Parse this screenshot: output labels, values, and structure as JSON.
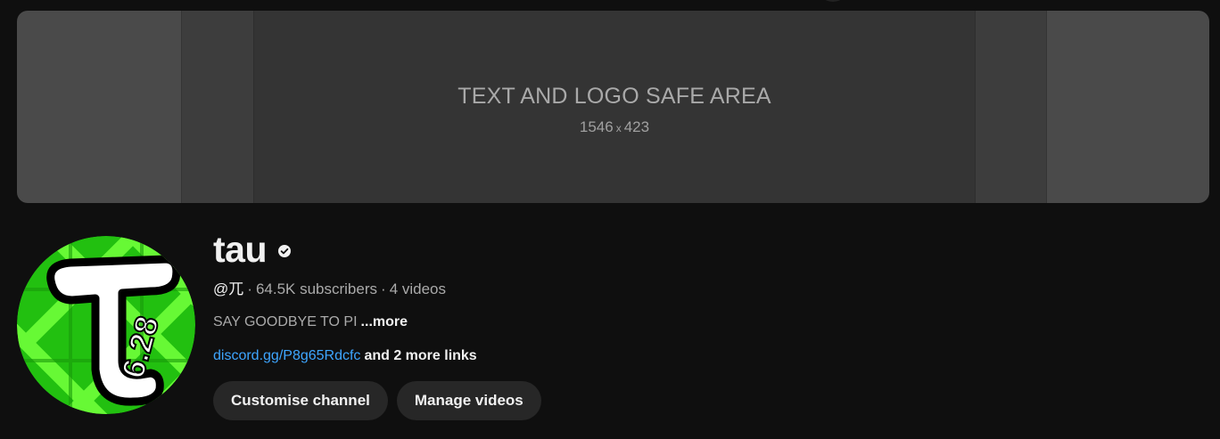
{
  "banner": {
    "safe_area_title": "TEXT AND LOGO SAFE AREA",
    "safe_area_width": "1546",
    "safe_area_x": "x",
    "safe_area_height": "423"
  },
  "avatar": {
    "text": "6.28",
    "colors": {
      "background": "#22c010",
      "pattern": "#6fff3a",
      "letter": "#ffffff",
      "outline": "#000000"
    }
  },
  "channel": {
    "name": "tau",
    "verified_icon": "verified-check-icon",
    "handle": "@兀",
    "separator": "·",
    "subscribers": "64.5K subscribers",
    "videos": "4 videos",
    "description": "SAY GOODBYE TO PI",
    "more_label": "...more",
    "link": "discord.gg/P8g65Rdcfc",
    "more_links": "and 2 more links"
  },
  "actions": {
    "customise_label": "Customise channel",
    "manage_label": "Manage videos"
  },
  "colors": {
    "background": "#0f0f0f",
    "link": "#3ea6ff",
    "button_bg": "#272727",
    "text_primary": "#f1f1f1",
    "text_secondary": "#aaaaaa"
  }
}
